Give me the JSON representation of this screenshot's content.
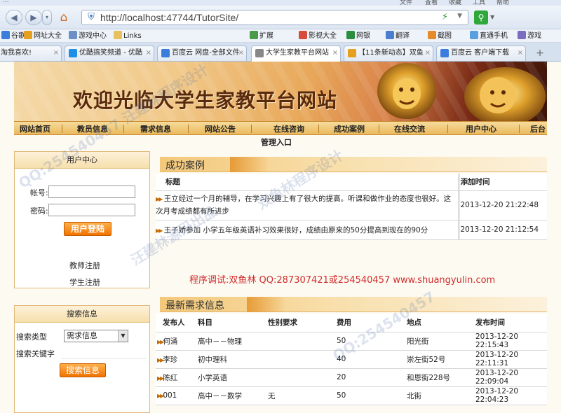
{
  "window": {
    "title": "...",
    "menus": [
      "文件",
      "查看",
      "收藏",
      "工具",
      "帮助"
    ]
  },
  "address_bar": {
    "url": "http://localhost:47744/TutorSite/"
  },
  "bookmarks": [
    {
      "label": "谷歌",
      "color": "#3b7ddd"
    },
    {
      "label": "网址大全",
      "color": "#e6a020"
    },
    {
      "label": "游戏中心",
      "color": "#6b8fc9"
    },
    {
      "label": "Links",
      "color": "#e8c060"
    },
    {
      "label": "扩展",
      "color": "#4a9a4a"
    },
    {
      "label": "影视大全",
      "color": "#d84a3a"
    },
    {
      "label": "网银",
      "color": "#2b8d3e"
    },
    {
      "label": "翻译",
      "color": "#4a7fd0"
    },
    {
      "label": "截图",
      "color": "#e58b2a"
    },
    {
      "label": "直通手机",
      "color": "#5aa0e0"
    },
    {
      "label": "游戏",
      "color": "#7a6cc0"
    }
  ],
  "tabs": [
    {
      "label": "网 - 淘我喜欢!",
      "color": "#e85a2a"
    },
    {
      "label": "优酷搞笑频道 - 优酷",
      "color": "#1e8ee6"
    },
    {
      "label": "百度云 网盘-全部文件",
      "color": "#3b7ddd"
    },
    {
      "label": "大学生家教平台网站",
      "color": "#888888",
      "active": true
    },
    {
      "label": "【11条新动态】双鱼",
      "color": "#e6a020"
    },
    {
      "label": "百度云 客户端下载",
      "color": "#3b7ddd"
    }
  ],
  "site": {
    "banner_title": "欢迎光临大学生家教平台网站",
    "nav": [
      "网站首页",
      "教员信息",
      "需求信息",
      "网站公告",
      "在线咨询",
      "成功案例",
      "在线交流",
      "用户中心",
      "后台"
    ],
    "nav_row2": "管理入口",
    "user_panel": {
      "title": "用户中心",
      "account_label": "帐号:",
      "password_label": "密码:",
      "login_button": "用户登陆",
      "teacher_register": "教师注册",
      "student_register": "学生注册"
    },
    "search_panel": {
      "title": "搜索信息",
      "type_label": "搜索类型",
      "type_value": "需求信息",
      "keyword_label": "搜索关键字",
      "search_button": "搜索信息"
    },
    "cases": {
      "title": "成功案例",
      "headers": [
        "标题",
        "添加时间"
      ],
      "rows": [
        {
          "title": "王立经过一个月的辅导，在学习兴趣上有了很大的提高。听课和做作业的态度也很好。这次月考成绩都有所进步",
          "time": "2013-12-20 21:22:48"
        },
        {
          "title": "王子娇参加 小学五年级英语补习效果很好，成绩由原来的50分提高到现在的90分",
          "time": "2013-12-20 21:12:54"
        }
      ]
    },
    "debug_text": "程序调试:双鱼林 QQ:287307421或254540457 www.shuangyulin.com",
    "demands": {
      "title": "最新需求信息",
      "headers": [
        "发布人",
        "科目",
        "性别要求",
        "费用",
        "地点",
        "发布时间"
      ],
      "rows": [
        {
          "publisher": "何涌",
          "subject": "高中－－物理",
          "gender": "",
          "fee": "50",
          "place": "阳光街",
          "time": "2013-12-20 22:15:43"
        },
        {
          "publisher": "李珍",
          "subject": "初中理科",
          "gender": "",
          "fee": "40",
          "place": "崇左街52号",
          "time": "2013-12-20 22:11:31"
        },
        {
          "publisher": "陈红",
          "subject": "小学英语",
          "gender": "",
          "fee": "20",
          "place": "和恩街228号",
          "time": "2013-12-20 22:09:04"
        },
        {
          "publisher": "001",
          "subject": "高中－－数学",
          "gender": "无",
          "fee": "50",
          "place": "北街",
          "time": "2013-12-20 22:04:23"
        }
      ]
    }
  },
  "watermark": [
    "QQ:254540457 汪建林程序设计",
    "汪建林源码出品",
    "双鱼林程序设计",
    "QQ:254540457"
  ]
}
